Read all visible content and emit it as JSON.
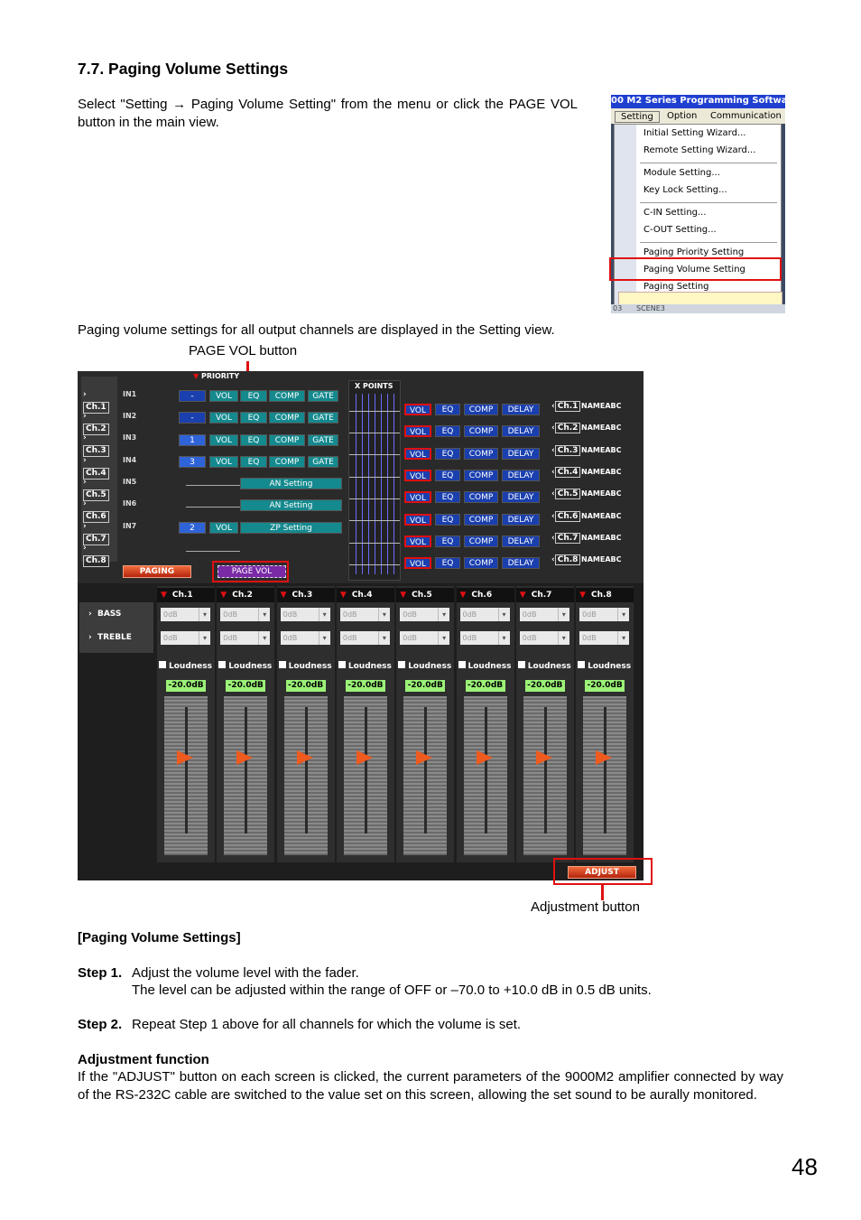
{
  "heading": "7.7. Paging Volume Settings",
  "intro": "Select \"Setting → Paging Volume Setting\" from the menu or click the PAGE VOL button in the main view.",
  "menu_screenshot": {
    "title": "00 M2 Series Programming Softwa",
    "menubar": [
      "Setting",
      "Option",
      "Communication"
    ],
    "items": [
      "Initial Setting Wizard...",
      "Remote Setting Wizard...",
      "Module Setting...",
      "Key Lock Setting...",
      "C-IN Setting...",
      "C-OUT Setting...",
      "Paging Priority Setting",
      "Paging Volume Setting",
      "Paging Setting"
    ],
    "status": "SCENE3",
    "status_left": "03"
  },
  "caption_settings": "Paging volume settings for all output channels are displayed in the Setting view.",
  "callout_page_vol": "PAGE VOL button",
  "callout_adjust": "Adjustment button",
  "main_screenshot": {
    "priority_label": "PRIORITY",
    "xpoints_label": "X POINTS",
    "channels": [
      "Ch.1",
      "Ch.2",
      "Ch.3",
      "Ch.4",
      "Ch.5",
      "Ch.6",
      "Ch.7",
      "Ch.8"
    ],
    "inputs": [
      "IN1",
      "IN2",
      "IN3",
      "IN4",
      "IN5",
      "IN6",
      "IN7"
    ],
    "priority_values": [
      "-",
      "-",
      "1",
      "3",
      "",
      "",
      "2"
    ],
    "input_buttons": [
      "VOL",
      "EQ",
      "COMP",
      "GATE"
    ],
    "an_setting": "AN Setting",
    "zp_setting": "ZP Setting",
    "output_buttons": [
      "VOL",
      "EQ",
      "COMP",
      "DELAY"
    ],
    "output_name": "NAMEABC",
    "paging_button": "PAGING",
    "page_vol_button": "PAGE VOL",
    "bass_label": "BASS",
    "treble_label": "TREBLE",
    "bass_value": "0dB",
    "treble_value": "0dB",
    "loudness_label": "Loudness",
    "level_value": "-20.0dB",
    "adjust_button": "ADJUST"
  },
  "section_title": "[Paging Volume Settings]",
  "step1_label": "Step 1.",
  "step1_text": "Adjust the volume level with the fader.",
  "step1_sub": "The level can be adjusted within the range of OFF or –70.0 to +10.0 dB in 0.5 dB units.",
  "step2_label": "Step 2.",
  "step2_text": "Repeat Step 1 above for all channels for which the volume is set.",
  "adj_title": "Adjustment function",
  "adj_text": "If the \"ADJUST\" button on each screen is clicked, the current parameters of the 9000M2 amplifier connected by way of the RS-232C cable are switched to the value set on this screen, allowing the set sound to be aurally monitored.",
  "page_number": "48"
}
